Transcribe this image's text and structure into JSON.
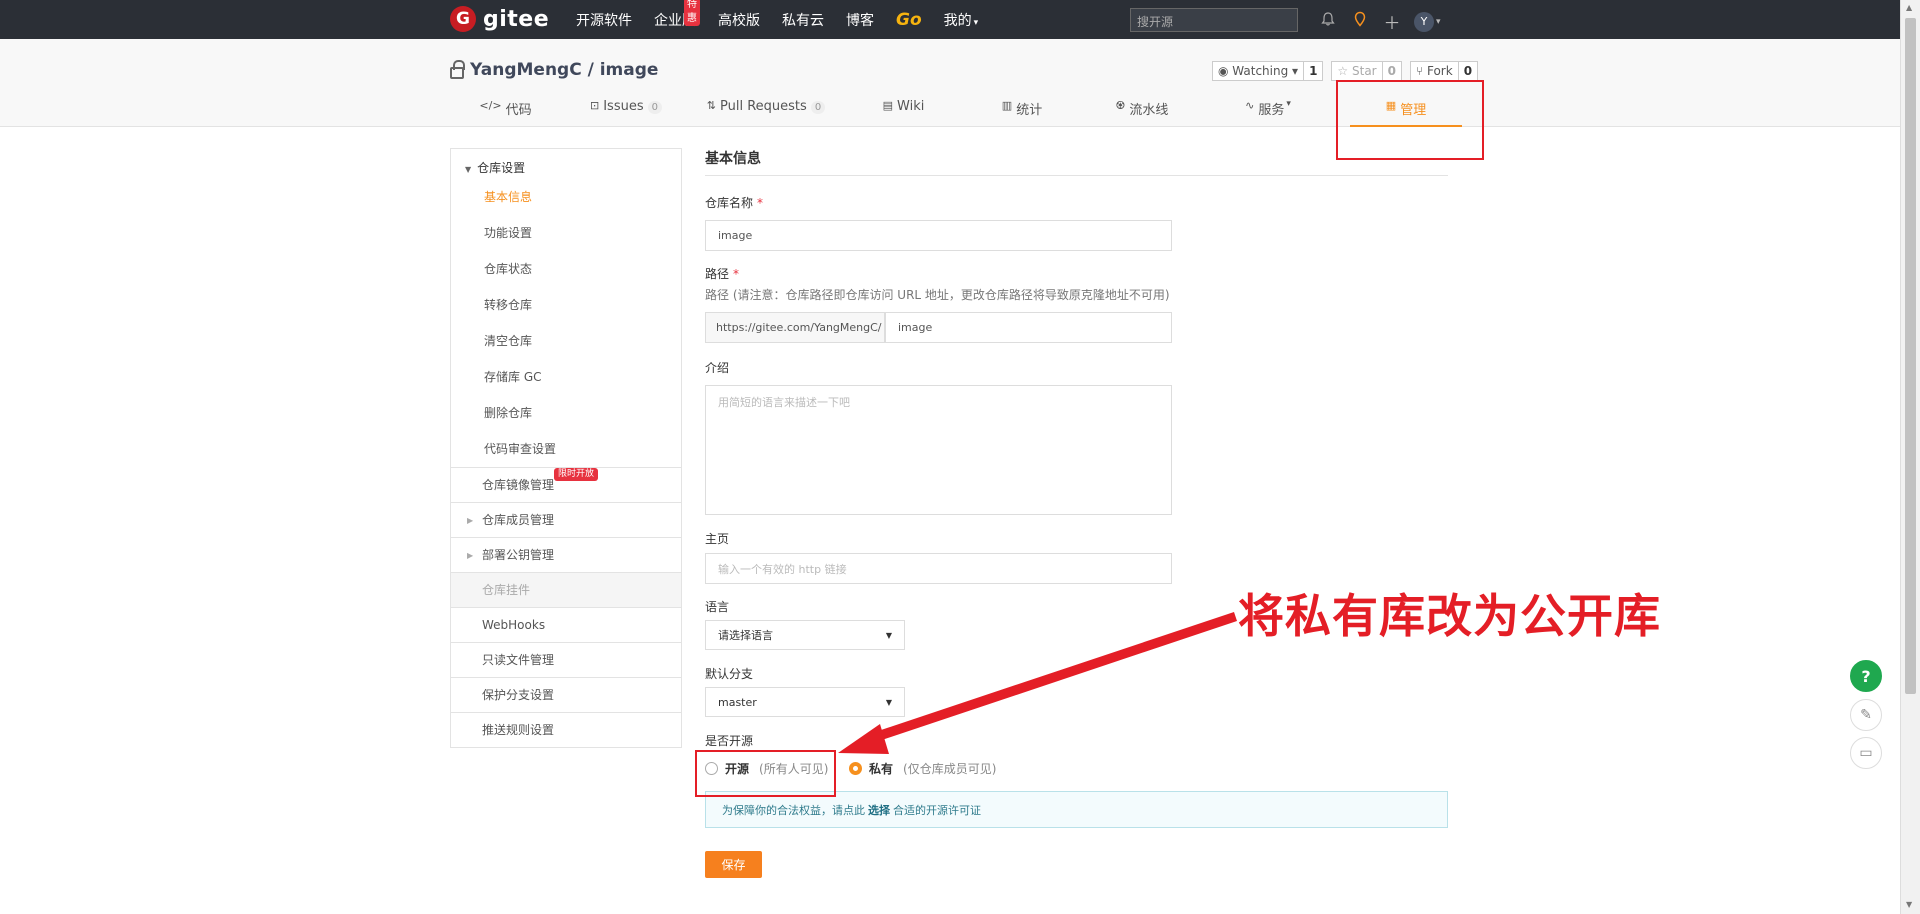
{
  "topnav": {
    "logo_text": "gitee",
    "logo_mark": "G",
    "items": [
      "开源软件",
      "企业版",
      "高校版",
      "私有云",
      "博客"
    ],
    "enterprise_badge": "特惠",
    "go_label": "Go",
    "mine_label": "我的",
    "search_placeholder": "搜开源",
    "avatar_letter": "Y"
  },
  "repo": {
    "title": "YangMengC / image",
    "watch_label": "Watching",
    "watch_count": "1",
    "star_label": "Star",
    "star_count": "0",
    "fork_label": "Fork",
    "fork_count": "0"
  },
  "tabs": [
    {
      "label": "代码",
      "icon": "code-icon",
      "icon_char": "</>"
    },
    {
      "label": "Issues",
      "icon": "issues-icon",
      "icon_char": "⊡",
      "count": "0"
    },
    {
      "label": "Pull Requests",
      "icon": "pull-request-icon",
      "icon_char": "⇅",
      "count": "0"
    },
    {
      "label": "Wiki",
      "icon": "wiki-icon",
      "icon_char": "▤"
    },
    {
      "label": "统计",
      "icon": "stats-icon",
      "icon_char": "▥"
    },
    {
      "label": "流水线",
      "icon": "pipeline-icon",
      "icon_char": "♼"
    },
    {
      "label": "服务",
      "icon": "service-icon",
      "icon_char": "∿"
    },
    {
      "label": "管理",
      "icon": "manage-icon",
      "icon_char": "▦"
    }
  ],
  "sidebar": {
    "section_title": "仓库设置",
    "sub_items": [
      "基本信息",
      "功能设置",
      "仓库状态",
      "转移仓库",
      "清空仓库",
      "存储库 GC",
      "删除仓库",
      "代码审查设置"
    ],
    "mirror_label": "仓库镜像管理",
    "limited_badge": "限时开放",
    "members_label": "仓库成员管理",
    "deploy_label": "部署公钥管理",
    "widget_label": "仓库挂件",
    "webhooks_label": "WebHooks",
    "readonly_label": "只读文件管理",
    "protect_label": "保护分支设置",
    "push_rules_label": "推送规则设置"
  },
  "form": {
    "title": "基本信息",
    "name_label": "仓库名称",
    "name_value": "image",
    "path_label": "路径",
    "path_hint": "路径 (请注意：仓库路径即仓库访问 URL 地址，更改仓库路径将导致原克隆地址不可用)",
    "path_prefix": "https://gitee.com/YangMengC/",
    "path_value": "image",
    "intro_label": "介绍",
    "intro_placeholder": "用简短的语言来描述一下吧",
    "homepage_label": "主页",
    "homepage_placeholder": "输入一个有效的 http 链接",
    "language_label": "语言",
    "language_value": "请选择语言",
    "branch_label": "默认分支",
    "branch_value": "master",
    "opensource_label": "是否开源",
    "open_label": "开源",
    "open_note": "(所有人可见)",
    "private_label": "私有",
    "private_note": "(仅仓库成员可见)",
    "notice_pre": "为保障你的合法权益，请点此",
    "notice_link": "选择",
    "notice_post": "合适的开源许可证",
    "save_label": "保存",
    "required_mark": "*"
  },
  "annotation": {
    "text": "将私有库改为公开库",
    "color": "#e41e26"
  },
  "float": {
    "help": "?"
  }
}
